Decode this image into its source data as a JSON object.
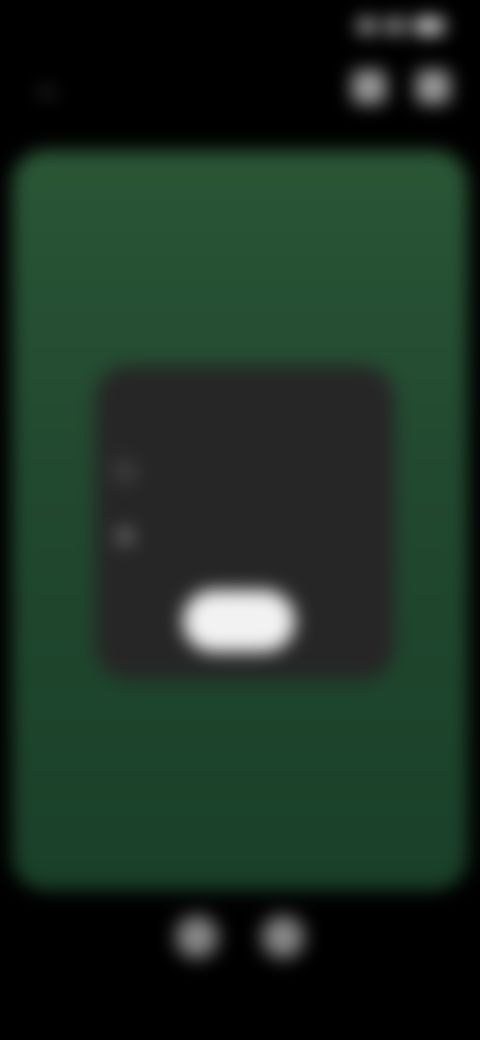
{
  "status_bar": {
    "time": "",
    "icons": [
      "signal-icon",
      "wifi-icon",
      "battery-icon"
    ]
  },
  "app_bar": {
    "title": "",
    "back_icon": "back-arrow-icon",
    "actions": [
      "action-icon-1",
      "action-icon-2"
    ]
  },
  "dialog": {
    "title": "",
    "rows": [
      {
        "icon": "info-icon",
        "text": ""
      },
      {
        "icon": "settings-icon",
        "text": ""
      }
    ],
    "ok_label": ""
  },
  "bottom_controls": {
    "icons": [
      "left-control-icon",
      "right-control-icon"
    ]
  },
  "colors": {
    "preview_green": "#224a30",
    "dialog_bg": "#262626",
    "button_bg": "#f2f2f2"
  }
}
